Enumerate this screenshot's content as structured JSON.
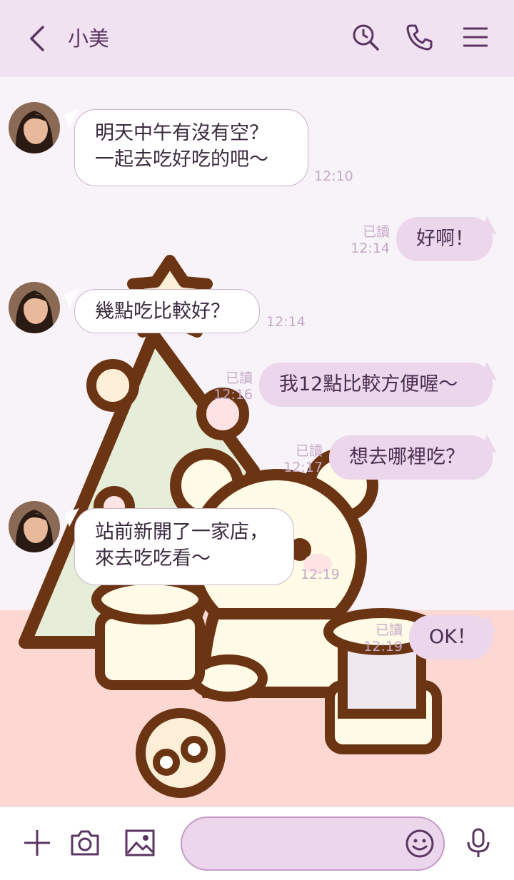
{
  "header": {
    "title": "小美",
    "back_icon": "chevron-left-icon",
    "icons": [
      "search-history-icon",
      "phone-icon",
      "menu-icon"
    ]
  },
  "messages": [
    {
      "side": "in",
      "text": "明天中午有沒有空？\n一起去吃好吃的吧～",
      "time": "12:10"
    },
    {
      "side": "out",
      "text": "好啊！",
      "read": "已讀",
      "time": "12:14"
    },
    {
      "side": "in",
      "text": "幾點吃比較好？",
      "time": "12:14"
    },
    {
      "side": "out",
      "text": "我12點比較方便喔～",
      "read": "已讀",
      "time": "12:16"
    },
    {
      "side": "out",
      "text": "想去哪裡吃？",
      "read": "已讀",
      "time": "12:17"
    },
    {
      "side": "in",
      "text": "站前新開了一家店，\n來去吃吃看～",
      "time": "12:19"
    },
    {
      "side": "out",
      "text": "OK！",
      "read": "已讀",
      "time": "12:19"
    }
  ],
  "bottombar": {
    "icons": [
      "plus-icon",
      "camera-icon",
      "image-icon",
      "emoji-icon",
      "microphone-icon"
    ],
    "input_value": ""
  },
  "colors": {
    "header_bg": "#f0e2f0",
    "out_bubble": "#ebd6ec",
    "accent": "#5b3563",
    "floor": "#fdd8d3"
  }
}
